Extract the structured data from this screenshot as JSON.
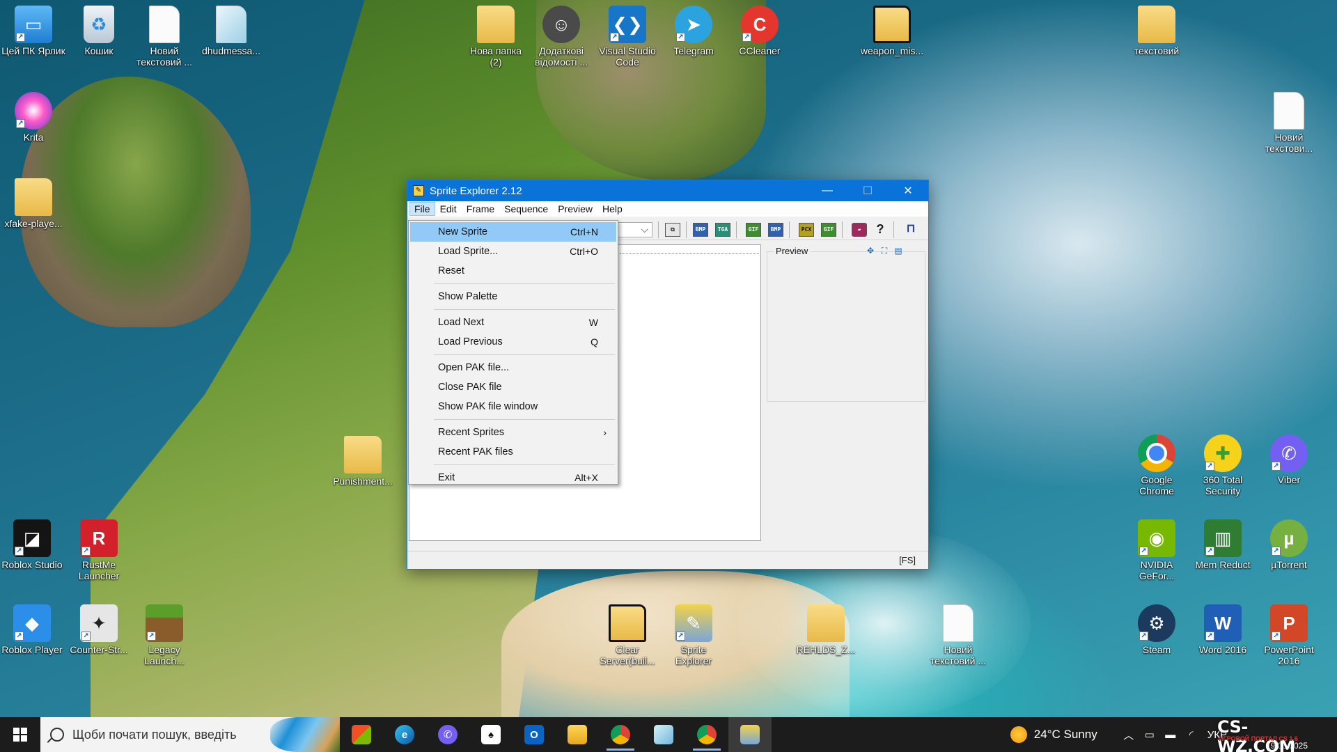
{
  "desktop": {
    "icons": [
      {
        "label": "Цей ПК Ярлик",
        "icon": "computer-icon"
      },
      {
        "label": "Кошик",
        "icon": "recycle-bin-icon"
      },
      {
        "label": "Новий текстовий ...",
        "icon": "text-document-icon"
      },
      {
        "label": "dhudmessa...",
        "icon": "file-icon"
      },
      {
        "label": "Krita",
        "icon": "krita-icon"
      },
      {
        "label": "xfake-playe...",
        "icon": "folder-icon"
      },
      {
        "label": "Нова папка (2)",
        "icon": "folder-icon"
      },
      {
        "label": "Додаткові відомості ...",
        "icon": "info-icon"
      },
      {
        "label": "Visual Studio Code",
        "icon": "vscode-icon"
      },
      {
        "label": "Telegram",
        "icon": "telegram-icon"
      },
      {
        "label": "CCleaner",
        "icon": "ccleaner-icon"
      },
      {
        "label": "weapon_mis...",
        "icon": "folder-icon"
      },
      {
        "label": "текстовий",
        "icon": "folder-icon"
      },
      {
        "label": "Новий текстови...",
        "icon": "text-document-icon"
      },
      {
        "label": "Punishment...",
        "icon": "folder-icon"
      },
      {
        "label": "Google Chrome",
        "icon": "chrome-icon"
      },
      {
        "label": "360 Total Security",
        "icon": "360-security-icon"
      },
      {
        "label": "Viber",
        "icon": "viber-icon"
      },
      {
        "label": "Roblox Studio",
        "icon": "roblox-studio-icon"
      },
      {
        "label": "RustMe Launcher",
        "icon": "rustme-icon"
      },
      {
        "label": "NVIDIA GeFor...",
        "icon": "nvidia-icon"
      },
      {
        "label": "Mem Reduct",
        "icon": "mem-reduct-icon"
      },
      {
        "label": "µTorrent",
        "icon": "utorrent-icon"
      },
      {
        "label": "Roblox Player",
        "icon": "roblox-icon"
      },
      {
        "label": "Counter-Str...",
        "icon": "counter-strike-icon"
      },
      {
        "label": "Legacy Launch...",
        "icon": "minecraft-icon"
      },
      {
        "label": "Clear Server(buil...",
        "icon": "folder-icon"
      },
      {
        "label": "Sprite Explorer",
        "icon": "sprite-explorer-icon"
      },
      {
        "label": "REHLDS_Z...",
        "icon": "folder-icon"
      },
      {
        "label": "Новий текстовий ...",
        "icon": "text-document-icon"
      },
      {
        "label": "Steam",
        "icon": "steam-icon"
      },
      {
        "label": "Word 2016",
        "icon": "word-icon"
      },
      {
        "label": "PowerPoint 2016",
        "icon": "powerpoint-icon"
      }
    ]
  },
  "window": {
    "title": "Sprite Explorer 2.12",
    "controls": {
      "minimize": "—",
      "maximize": "☐",
      "close": "✕"
    },
    "menu": [
      "File",
      "Edit",
      "Frame",
      "Sequence",
      "Preview",
      "Help"
    ],
    "toolbar": {
      "bmp": "BMP",
      "tga": "TGA",
      "gif": "GIF",
      "pcx": "PCX"
    },
    "preview_label": "Preview",
    "status": "[FS]"
  },
  "file_menu": {
    "items": [
      {
        "label": "New Sprite",
        "shortcut": "Ctrl+N"
      },
      {
        "label": "Load Sprite...",
        "shortcut": "Ctrl+O"
      },
      {
        "label": "Reset",
        "shortcut": ""
      },
      {
        "label": "Show Palette",
        "shortcut": ""
      },
      {
        "label": "Load Next",
        "shortcut": "W"
      },
      {
        "label": "Load Previous",
        "shortcut": "Q"
      },
      {
        "label": "Open PAK file...",
        "shortcut": ""
      },
      {
        "label": "Close PAK file",
        "shortcut": ""
      },
      {
        "label": "Show PAK file window",
        "shortcut": ""
      },
      {
        "label": "Recent Sprites",
        "shortcut": ""
      },
      {
        "label": "Recent PAK files",
        "shortcut": ""
      },
      {
        "label": "Exit",
        "shortcut": "Alt+X"
      }
    ]
  },
  "taskbar": {
    "search_placeholder": "Щоби почати пошук, введіть",
    "weather": "24°C  Sunny",
    "language": "УКР",
    "date": "19.08.2025",
    "watermark": "CS-WZ.COM",
    "watermark_sub": "ИГРОВОЙ ПОРТАЛ CS 1.6"
  },
  "colors": {
    "accent": "#0a73d9",
    "menu_highlight": "#91c9f7",
    "taskbar": "#1c1c1c"
  }
}
